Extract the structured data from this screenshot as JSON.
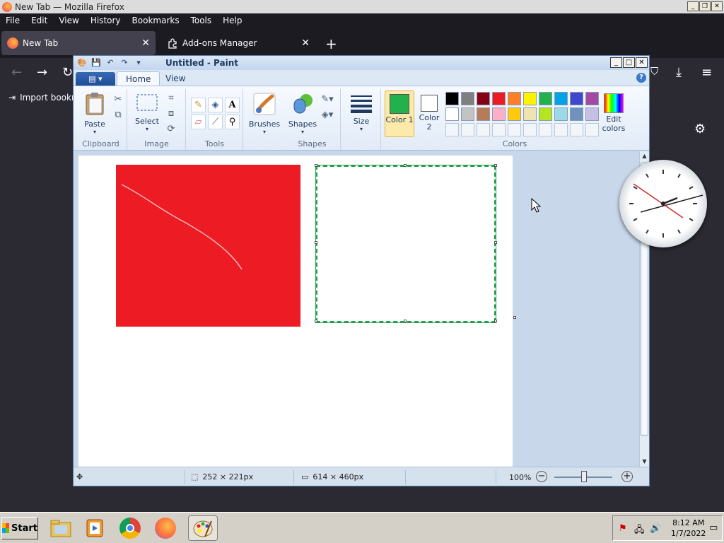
{
  "firefox": {
    "title": "New Tab — Mozilla Firefox",
    "menu": [
      "File",
      "Edit",
      "View",
      "History",
      "Bookmarks",
      "Tools",
      "Help"
    ],
    "tabs": [
      {
        "label": "New Tab",
        "active": true
      },
      {
        "label": "Add-ons Manager",
        "active": false
      }
    ],
    "bookmarks_label": "Import bookma"
  },
  "paint": {
    "title": "Untitled - Paint",
    "ribbon_tabs": [
      "Home",
      "View"
    ],
    "clipboard": {
      "paste_label": "Paste",
      "group_label": "Clipboard"
    },
    "image": {
      "select_label": "Select",
      "group_label": "Image"
    },
    "tools": {
      "group_label": "Tools"
    },
    "brushes_label": "Brushes",
    "shapes": {
      "shapes_label": "Shapes",
      "group_label": "Shapes"
    },
    "size_label": "Size",
    "color1_label": "Color 1",
    "color2_label": "Color 2",
    "colors_group_label": "Colors",
    "edit_colors_label": "Edit colors",
    "color1_value": "#22b14c",
    "color2_value": "#ffffff",
    "palette_row1": [
      "#000000",
      "#7f7f7f",
      "#880015",
      "#ed1c24",
      "#ff7f27",
      "#fff200",
      "#22b14c",
      "#00a2e8",
      "#3f48cc",
      "#a349a4"
    ],
    "palette_row2": [
      "#ffffff",
      "#c3c3c3",
      "#b97a57",
      "#ffaec9",
      "#ffc90e",
      "#efe4b0",
      "#b5e61d",
      "#99d9ea",
      "#7092be",
      "#c8bfe7"
    ],
    "status": {
      "selection_size": "252 × 221px",
      "image_size": "614 × 460px",
      "zoom": "100%"
    }
  },
  "taskbar": {
    "start_label": "Start",
    "time": "8:12 AM",
    "date": "1/7/2022"
  }
}
